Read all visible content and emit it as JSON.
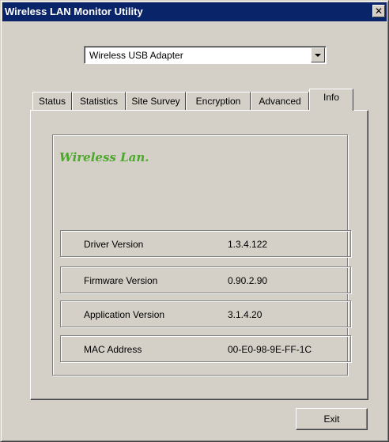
{
  "window": {
    "title": "Wireless LAN Monitor Utility",
    "close_glyph": "✕",
    "close_icon": "close-icon"
  },
  "adapter": {
    "selected": "Wireless USB Adapter"
  },
  "tabs": [
    {
      "label": "Status"
    },
    {
      "label": "Statistics"
    },
    {
      "label": "Site Survey"
    },
    {
      "label": "Encryption"
    },
    {
      "label": "Advanced"
    },
    {
      "label": "Info",
      "active": true
    }
  ],
  "info": {
    "brand": "Wireless Lan.",
    "rows": [
      {
        "label": "Driver Version",
        "value": "1.3.4.122"
      },
      {
        "label": "Firmware Version",
        "value": "0.90.2.90"
      },
      {
        "label": "Application Version",
        "value": "3.1.4.20"
      },
      {
        "label": "MAC Address",
        "value": "00-E0-98-9E-FF-1C"
      }
    ]
  },
  "buttons": {
    "exit": "Exit"
  },
  "colors": {
    "titlebar": "#0a246a",
    "face": "#d4d0c8",
    "brand_text": "#4ba82a"
  }
}
